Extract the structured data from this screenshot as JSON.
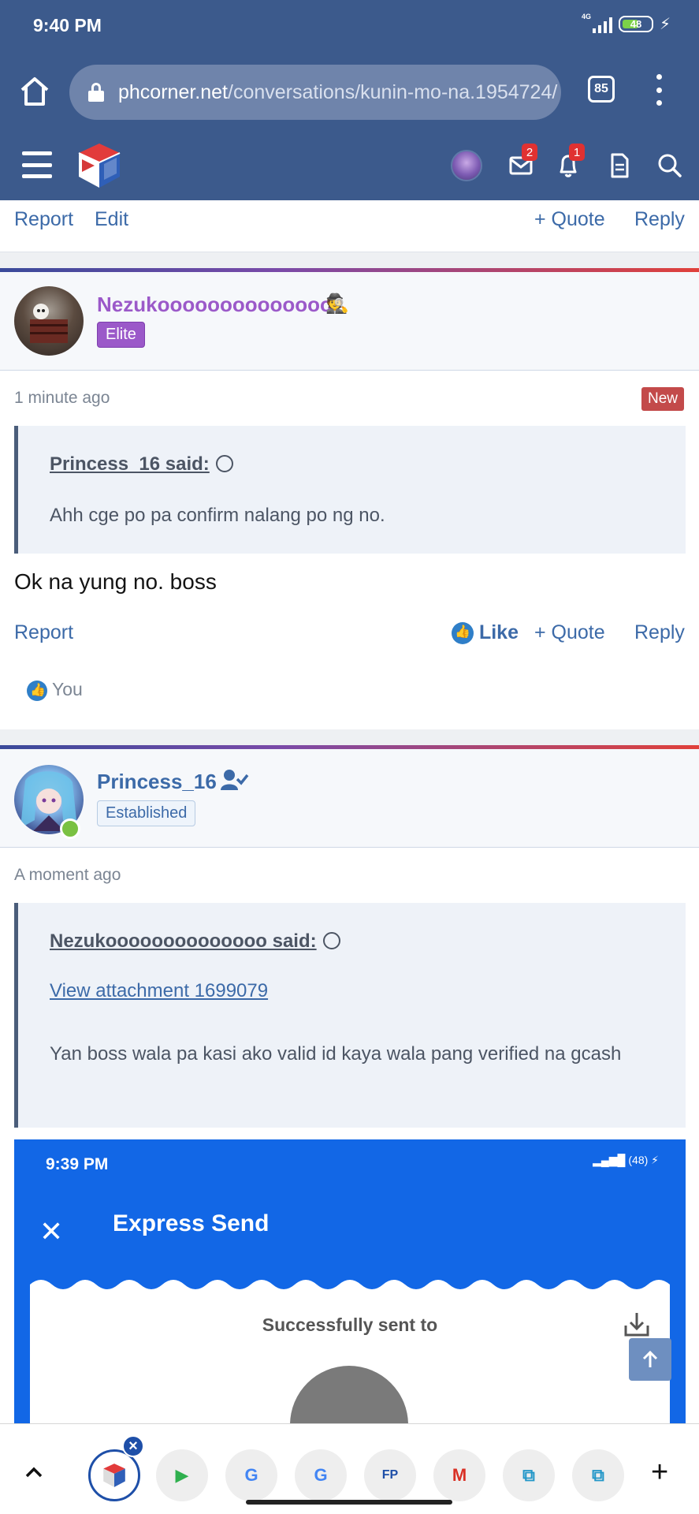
{
  "status_bar": {
    "time": "9:40 PM",
    "network": "4G",
    "battery": "48"
  },
  "browser": {
    "url_host": "phcorner.net",
    "url_path": "/conversations/kunin-mo-na.1954724/",
    "tab_count": "85"
  },
  "header": {
    "messages_badge": "2",
    "alerts_badge": "1"
  },
  "prev_post": {
    "report_label": "Report",
    "edit_label": "Edit",
    "quote_label": "+ Quote",
    "reply_label": "Reply"
  },
  "post1": {
    "username": "Nezukoooooooooooooo",
    "user_title": "Elite",
    "time": "1 minute ago",
    "new_label": "New",
    "quote_author": "Princess_16 said:",
    "quote_text": "Ahh cge po pa confirm nalang po ng no.",
    "message": "Ok na yung no. boss",
    "report_label": "Report",
    "like_label": "Like",
    "quote_label": "+ Quote",
    "reply_label": "Reply",
    "reactions_label": "You"
  },
  "post2": {
    "username": "Princess_16",
    "user_title": "Established",
    "time": "A moment ago",
    "quote_author": "Nezukoooooooooooooo said:",
    "quote_link": "View attachment 1699079",
    "quote_text": "Yan boss wala pa kasi ako valid id kaya wala pang verified na gcash"
  },
  "attachment": {
    "time": "9:39 PM",
    "battery": "48",
    "title": "Express Send",
    "sent_label": "Successfully sent to"
  },
  "bubbles": [
    {
      "name": "phcorner-bubble",
      "label": ""
    },
    {
      "name": "play-store-bubble",
      "label": "▶"
    },
    {
      "name": "google-bubble-1",
      "label": "G"
    },
    {
      "name": "google-bubble-2",
      "label": "G"
    },
    {
      "name": "fp-bubble",
      "label": "FP"
    },
    {
      "name": "gmail-bubble",
      "label": "M"
    },
    {
      "name": "app-bubble-1",
      "label": "⧉"
    },
    {
      "name": "app-bubble-2",
      "label": "⧉"
    }
  ],
  "colors": {
    "brand": "#3c5a8c",
    "link": "#3c6aa8",
    "elite": "#9b59c9",
    "established_text": "#3c6aa8",
    "new_badge": "#c34a4a",
    "express_blue": "#1267e6"
  }
}
